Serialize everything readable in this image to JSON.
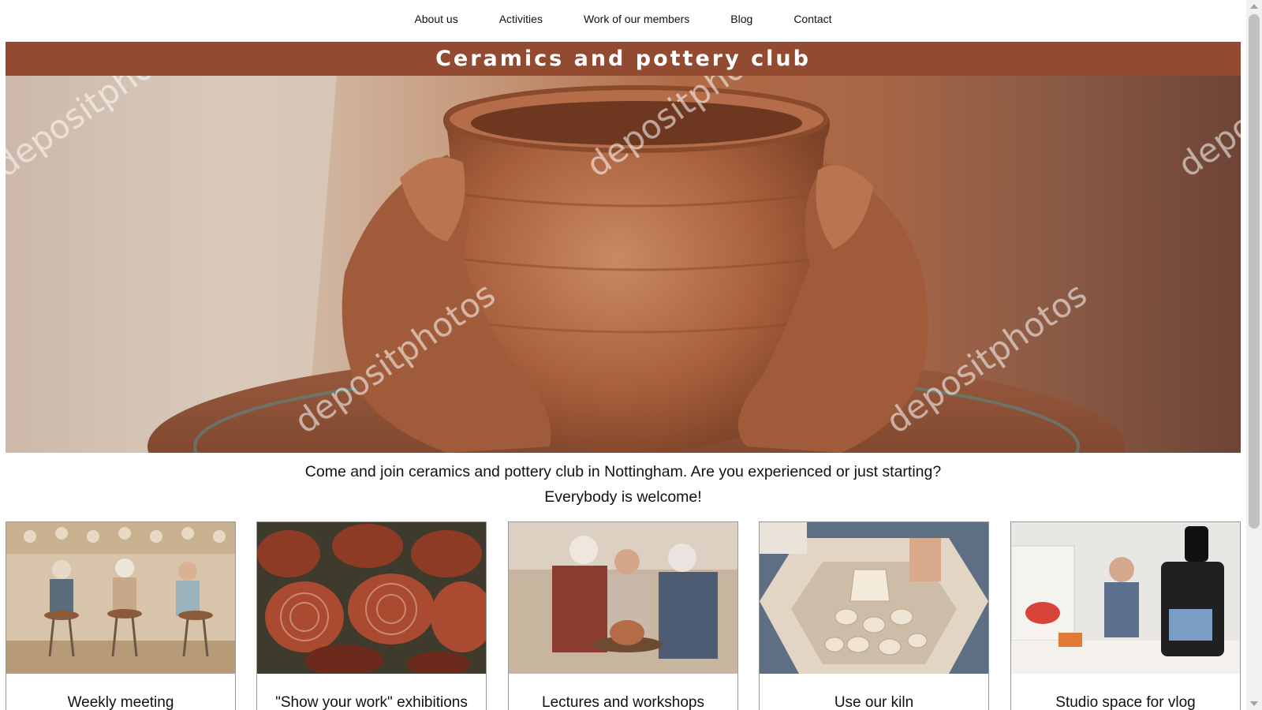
{
  "nav": {
    "items": [
      {
        "label": "About us"
      },
      {
        "label": "Activities"
      },
      {
        "label": "Work of our members"
      },
      {
        "label": "Blog"
      },
      {
        "label": "Contact"
      }
    ]
  },
  "banner": {
    "title": "Ceramics and pottery club"
  },
  "hero": {
    "watermark": "depositphotos"
  },
  "intro": {
    "line1": "Come and join ceramics and pottery club in Nottingham. Are you experienced or just starting?",
    "line2": "Everybody is welcome!"
  },
  "cards": [
    {
      "caption": "Weekly meeting"
    },
    {
      "caption": "\"Show your work\" exhibitions"
    },
    {
      "caption": "Lectures and workshops"
    },
    {
      "caption": "Use our kiln"
    },
    {
      "caption": "Studio space for vlog"
    }
  ],
  "colors": {
    "banner": "#924b31",
    "clay": "#b06a45",
    "text": "#111111"
  }
}
